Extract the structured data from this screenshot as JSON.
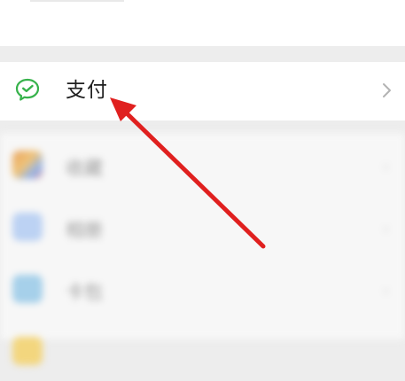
{
  "pay_item": {
    "label": "支付",
    "icon": "wechat-pay-icon",
    "chevron": "chevron-right-icon",
    "accent_color": "#36b24b"
  },
  "blurred_items": [
    {
      "label": "收藏",
      "icon": "favorites-icon",
      "color": "#e9a86a"
    },
    {
      "label": "相册",
      "icon": "album-icon",
      "color": "#b9d0f3"
    },
    {
      "label": "卡包",
      "icon": "card-package-icon",
      "color": "#9bc9e8"
    },
    {
      "label": "",
      "icon": "sticker-icon",
      "color": "#f1d27a"
    }
  ],
  "annotation": {
    "arrow_color": "#e0201f"
  }
}
